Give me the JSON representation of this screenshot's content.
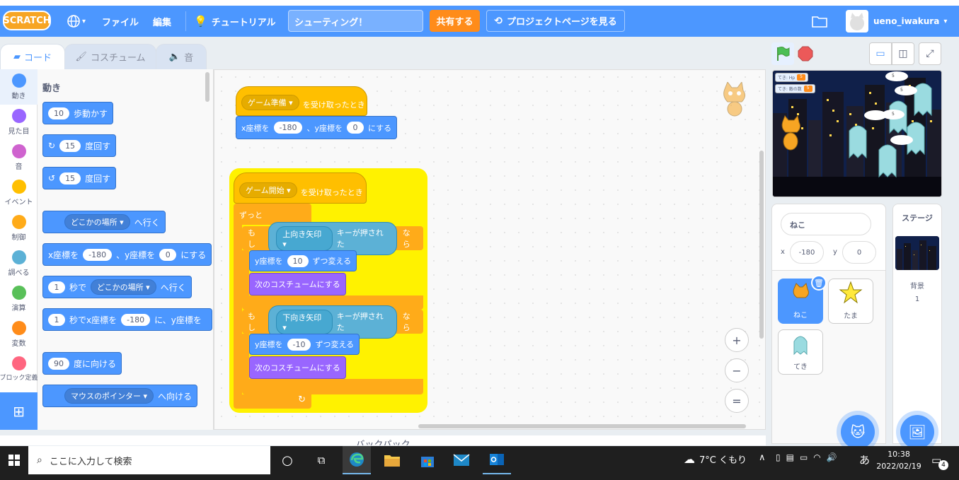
{
  "menubar": {
    "logo": "SCRATCH",
    "globe_caret": "▾",
    "file": "ファイル",
    "edit": "編集",
    "tutorial": "チュートリアル",
    "project_title": "シューティング！",
    "share": "共有する",
    "see_project_page": "プロジェクトページを見る",
    "username": "ueno_iwakura"
  },
  "tabs": [
    {
      "label": "コード"
    },
    {
      "label": "コスチューム"
    },
    {
      "label": "音"
    }
  ],
  "categories": [
    {
      "label": "動き",
      "color": "#4c97ff"
    },
    {
      "label": "見た目",
      "color": "#9966ff"
    },
    {
      "label": "音",
      "color": "#cf63cf"
    },
    {
      "label": "イベント",
      "color": "#ffbf00"
    },
    {
      "label": "制御",
      "color": "#ffab19"
    },
    {
      "label": "調べる",
      "color": "#5cb1d6"
    },
    {
      "label": "演算",
      "color": "#59c059"
    },
    {
      "label": "変数",
      "color": "#ff8c1a"
    },
    {
      "label": "ブロック定義",
      "color": "#ff6680"
    }
  ],
  "palette": {
    "heading": "動き",
    "move": {
      "val": "10",
      "text": "歩動かす"
    },
    "turn_right": {
      "val": "15",
      "text": "度回す"
    },
    "turn_left": {
      "val": "15",
      "text": "度回す"
    },
    "goto": {
      "dd": "どこかの場所 ▾",
      "text": "へ行く"
    },
    "goto_xy": {
      "x_label": "x座標を",
      "x": "-180",
      "y_label": "、y座標を",
      "y": "0",
      "text": "にする"
    },
    "glide": {
      "val": "1",
      "mid": "秒で",
      "dd": "どこかの場所 ▾",
      "text": "へ行く"
    },
    "glide_xy": {
      "val": "1",
      "mid": "秒でx座標を",
      "x": "-180",
      "mid2": "に、y座標を"
    },
    "point_dir": {
      "val": "90",
      "text": "度に向ける"
    },
    "point_towards": {
      "dd": "マウスのポインター ▾",
      "text": "へ向ける"
    }
  },
  "scripts": {
    "s1_hat": {
      "dd": "ゲーム準備 ▾",
      "text": "を受け取ったとき"
    },
    "s1_goto": {
      "x_label": "x座標を",
      "x": "-180",
      "y_label": "、y座標を",
      "y": "0",
      "text": "にする"
    },
    "s2_hat": {
      "dd": "ゲーム開始 ▾",
      "text": "を受け取ったとき"
    },
    "forever": "ずっと",
    "if1": {
      "if": "もし",
      "key": "上向き矢印 ▾",
      "cond": "キーが押された",
      "then": "なら"
    },
    "change_y1": {
      "label": "y座標を",
      "val": "10",
      "text": "ずつ変える"
    },
    "next_costume1": "次のコスチュームにする",
    "if2": {
      "if": "もし",
      "key": "下向き矢印 ▾",
      "cond": "キーが押された",
      "then": "なら"
    },
    "change_y2": {
      "label": "y座標を",
      "val": "-10",
      "text": "ずつ変える"
    },
    "next_costume2": "次のコスチュームにする",
    "loop_arrow": "↻"
  },
  "zoom": {
    "in": "+",
    "out": "−",
    "reset": "="
  },
  "backpack": "バックパック",
  "stage": {
    "var1_label": "てき: Hp",
    "var1_val": "5",
    "var2_label": "てき: 敵の数",
    "var2_val": "5",
    "bubbles": [
      "5",
      "5",
      "5"
    ]
  },
  "sprite_info": {
    "name": "ねこ",
    "x_label": "x",
    "x": "-180",
    "y_label": "y",
    "y": "0"
  },
  "sprites": [
    {
      "name": "ねこ"
    },
    {
      "name": "たま"
    },
    {
      "name": "てき"
    }
  ],
  "stage_pane": {
    "title": "ステージ",
    "backdrop_label": "背景",
    "backdrop_count": "1"
  },
  "taskbar": {
    "search_placeholder": "ここに入力して検索",
    "weather": "7°C くもり",
    "ime": "あ",
    "time": "10:38",
    "date": "2022/02/19",
    "notif_count": "4"
  }
}
